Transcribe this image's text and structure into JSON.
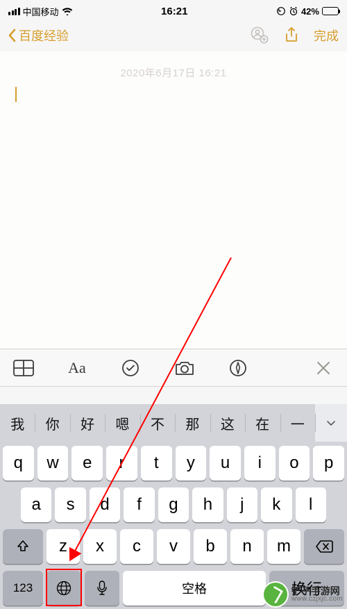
{
  "status": {
    "carrier": "中国移动",
    "time": "16:21",
    "battery_percent": "42%",
    "alarm_icon": "alarm"
  },
  "nav": {
    "back_label": "百度经验",
    "done_label": "完成"
  },
  "note": {
    "date_text": "2020年6月17日 16:21"
  },
  "toolbar": {
    "items": [
      "table",
      "text-format",
      "checklist",
      "camera",
      "markup"
    ],
    "aa_label": "Aa"
  },
  "keyboard": {
    "suggestions": [
      "我",
      "你",
      "好",
      "嗯",
      "不",
      "那",
      "这",
      "在",
      "一"
    ],
    "rows": {
      "top": [
        "q",
        "w",
        "e",
        "r",
        "t",
        "y",
        "u",
        "i",
        "o",
        "p"
      ],
      "mid": [
        "a",
        "s",
        "d",
        "f",
        "g",
        "h",
        "j",
        "k",
        "l"
      ],
      "bot": [
        "z",
        "x",
        "c",
        "v",
        "b",
        "n",
        "m"
      ]
    },
    "numbers_label": "123",
    "space_label": "空格",
    "return_label": "换行"
  },
  "watermark": {
    "site_name": "铲子手游网",
    "site_url": "www.czjxjc.com"
  }
}
